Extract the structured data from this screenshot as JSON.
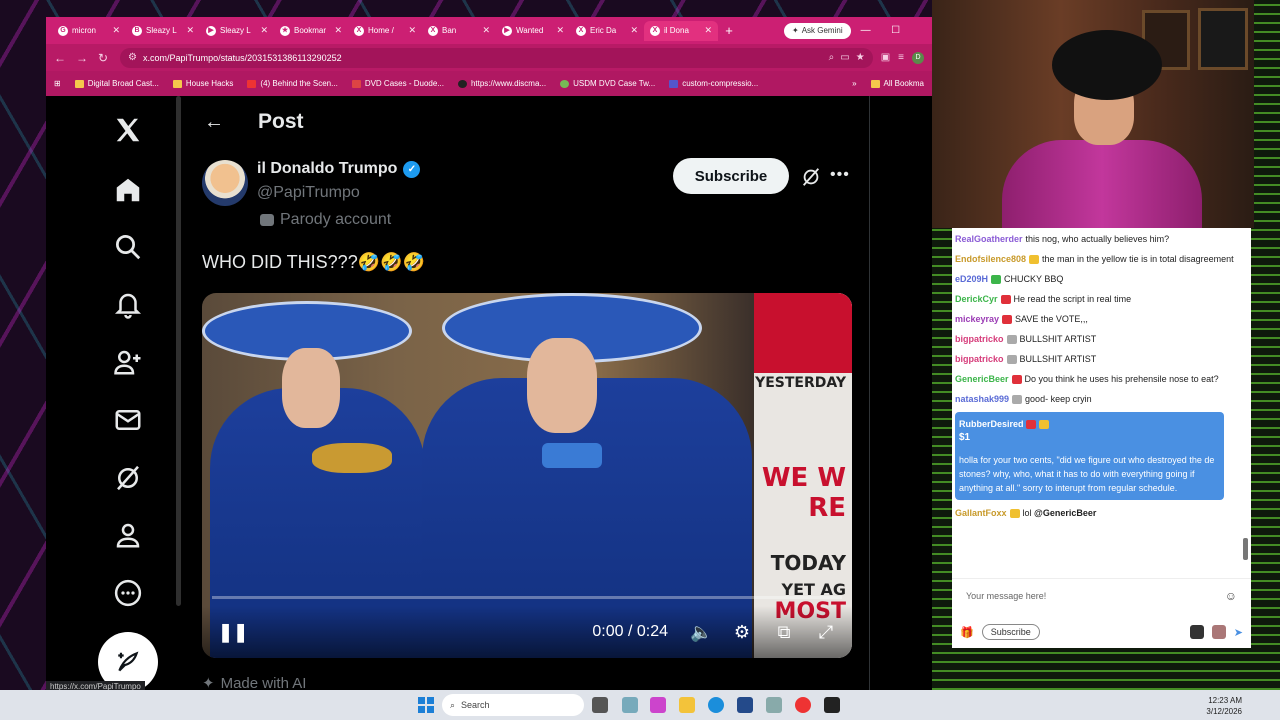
{
  "browser": {
    "tabs": [
      {
        "title": "micron",
        "icon": "G"
      },
      {
        "title": "Sleazy L",
        "icon": "B"
      },
      {
        "title": "Sleazy L",
        "icon": "▶"
      },
      {
        "title": "Bookmar",
        "icon": "★"
      },
      {
        "title": "Home /",
        "icon": "X"
      },
      {
        "title": "Ban",
        "icon": "X"
      },
      {
        "title": "Wanted",
        "icon": "▶"
      },
      {
        "title": "Eric Da",
        "icon": "X"
      },
      {
        "title": "il Dona",
        "icon": "X"
      }
    ],
    "new_tab_label": "+",
    "ask_gemini_label": "Ask Gemini",
    "url": "x.com/PapiTrumpo/status/2031531386113290252",
    "profile_initial": "D",
    "bookmarks": [
      "Digital Broad Cast...",
      "House Hacks",
      "(4) Behind the Scen...",
      "DVD Cases - Duode...",
      "https://www.discma...",
      "USDM DVD Case Tw...",
      "custom-compressio..."
    ],
    "all_bookmarks_label": "All Bookma",
    "status_url": "https://x.com/PapiTrumpo"
  },
  "post": {
    "page_title": "Post",
    "author_name": "il Donaldo Trumpo",
    "author_handle": "@PapiTrumpo",
    "parody_label": "Parody account",
    "subscribe_label": "Subscribe",
    "text": "WHO DID THIS???🤣🤣🤣",
    "video_time": "0:00 / 0:24",
    "video_progress": 0,
    "poster_text": [
      "YESTERDAY",
      "WE W",
      "RE",
      "TODAY",
      "YET AG",
      "MOST"
    ],
    "ai_label": "Made with AI"
  },
  "chat": {
    "messages": [
      {
        "user": "RealGoatherder",
        "color": "#8b5cd6",
        "badge": "",
        "text": "this nog, who actually believes him?"
      },
      {
        "user": "Endofsilence808",
        "color": "#c89a2a",
        "badge": "#f0c030",
        "text": "the man in the yellow tie is in total disagreement"
      },
      {
        "user": "eD209H",
        "color": "#5a6bd6",
        "badge": "#3cb54a",
        "text": "CHUCKY BBQ"
      },
      {
        "user": "DerickCyr",
        "color": "#3cb54a",
        "badge": "#e0303a",
        "text": "He read the script in real time"
      },
      {
        "user": "mickeyray",
        "color": "#9b3cb5",
        "badge": "#e0303a",
        "text": "SAVE the VOTE,,,"
      },
      {
        "user": "bigpatricko",
        "color": "#d63c7a",
        "badge": "#aaaaaa",
        "text": "BULLSHIT ARTIST"
      },
      {
        "user": "bigpatricko",
        "color": "#d63c7a",
        "badge": "#aaaaaa",
        "text": "BULLSHIT ARTIST"
      },
      {
        "user": "GenericBeer",
        "color": "#3cb54a",
        "badge": "#e0303a",
        "text": "Do you think he uses his prehensile nose to eat?"
      },
      {
        "user": "natashak999",
        "color": "#5a6bd6",
        "badge": "#aaaaaa",
        "text": "good- keep cryin"
      }
    ],
    "superchat": {
      "user": "RubberDesired",
      "amount": "$1",
      "text": "holla for your two cents, \"did we figure out who destroyed the de stones? why, who, what it has to do with everything going if anything at all.\" sorry to interupt from regular schedule."
    },
    "last_message": {
      "user": "GallantFoxx",
      "color": "#c89a2a",
      "text": "lol",
      "mention": "@GenericBeer"
    },
    "input_placeholder": "Your message here!",
    "subscribe_label": "Subscribe"
  },
  "taskbar": {
    "search_placeholder": "Search",
    "time": "12:23 AM",
    "date": "3/12/2026"
  }
}
